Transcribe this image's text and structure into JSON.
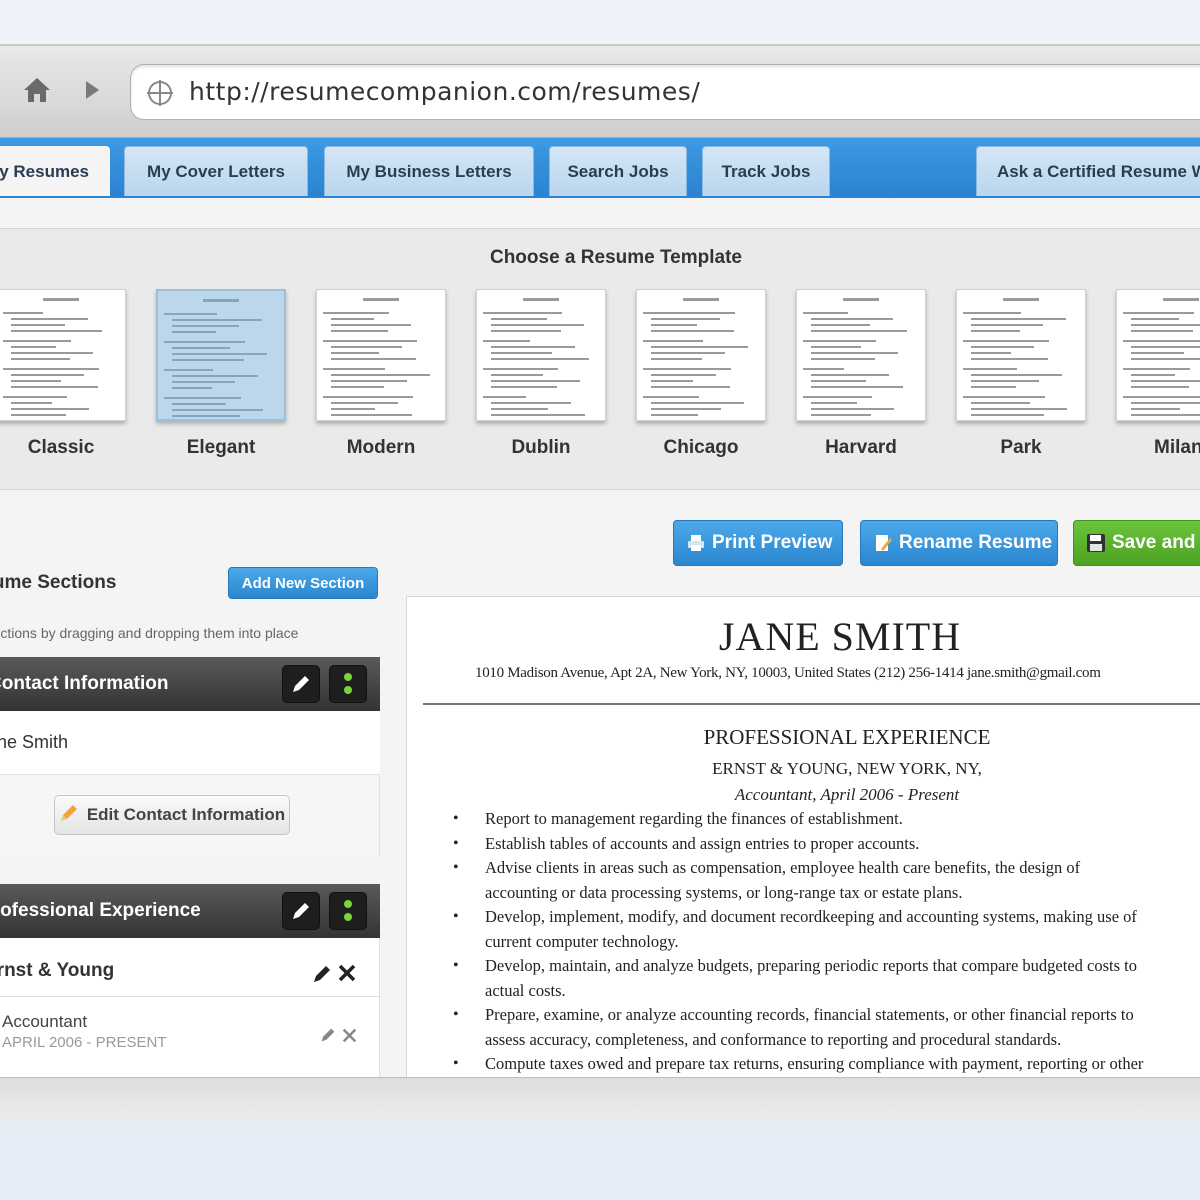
{
  "browser": {
    "url": "http://resumecompanion.com/resumes/"
  },
  "tabs": [
    {
      "label": "My Resumes"
    },
    {
      "label": "My Cover Letters"
    },
    {
      "label": "My Business Letters"
    },
    {
      "label": "Search Jobs"
    },
    {
      "label": "Track Jobs"
    },
    {
      "label": "Ask a Certified Resume Writer"
    }
  ],
  "gallery": {
    "title": "Choose a Resume Template",
    "templates": [
      "Classic",
      "Elegant",
      "Modern",
      "Dublin",
      "Chicago",
      "Harvard",
      "Park",
      "Milan"
    ],
    "selected": "Elegant"
  },
  "actions": {
    "print_preview": "Print Preview",
    "rename_resume": "Rename Resume",
    "save_and": "Save and Download"
  },
  "sections_panel": {
    "title": "Resume Sections",
    "add_new": "Add New Section",
    "hint": "Sort sections by dragging and dropping them into place",
    "contact": {
      "header": "Contact Information",
      "value": "Jane Smith",
      "edit_button": "Edit Contact Information"
    },
    "experience": {
      "header": "Professional Experience",
      "company": "Ernst & Young",
      "role": "Accountant",
      "dates": "APRIL 2006 - PRESENT"
    }
  },
  "resume": {
    "name": "JANE SMITH",
    "contact_line": "1010 Madison Avenue, Apt 2A, New York, NY, 10003, United States    (212) 256-1414    jane.smith@gmail.com",
    "section_heading": "PROFESSIONAL EXPERIENCE",
    "company_line": "ERNST & YOUNG, NEW YORK, NY,",
    "role_line": "Accountant,  April 2006 - Present",
    "bullets": [
      "Report to management regarding the finances of establishment.",
      "Establish tables of accounts and assign entries to proper accounts.",
      "Advise clients in areas such as compensation, employee health care benefits, the design of",
      "accounting or data processing systems, or long-range tax or estate plans.",
      "Develop, implement, modify, and document recordkeeping and accounting systems, making use of",
      "current computer technology.",
      "Develop, maintain, and analyze budgets, preparing periodic reports that compare budgeted costs to",
      "actual costs.",
      "Prepare, examine, or analyze accounting records, financial statements, or other financial reports to",
      "assess accuracy, completeness, and conformance to reporting and procedural standards.",
      "Compute taxes owed and prepare tax returns, ensuring compliance with payment, reporting or other"
    ]
  }
}
